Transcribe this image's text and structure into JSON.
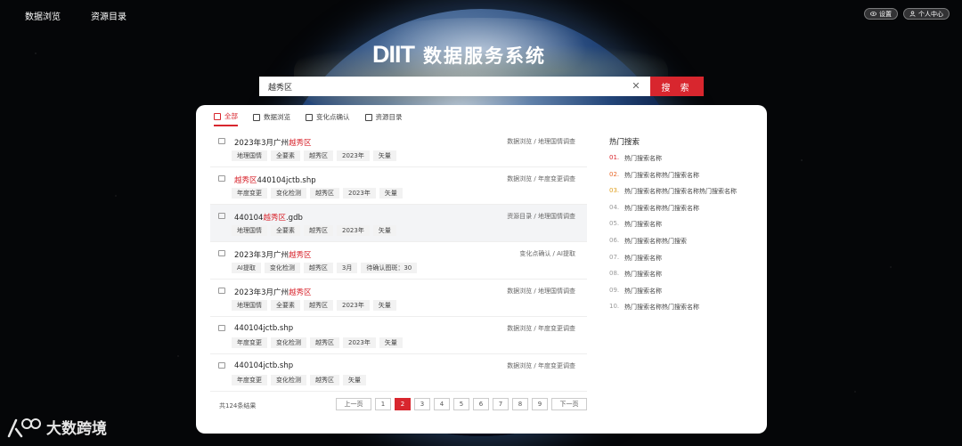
{
  "nav": [
    "数据浏览",
    "资源目录"
  ],
  "topright": {
    "settings": "设置",
    "user": "个人中心"
  },
  "brand": {
    "logo": "DIIT",
    "title": "数据服务系统"
  },
  "search": {
    "value": "越秀区",
    "button": "搜 索"
  },
  "tabs": [
    {
      "label": "全部",
      "active": true
    },
    {
      "label": "数据浏览"
    },
    {
      "label": "变化点确认"
    },
    {
      "label": "资源目录"
    }
  ],
  "results": [
    {
      "pre": "2023年3月广州",
      "hl": "越秀区",
      "post": "",
      "path": "数据浏览 / 地理国情调查",
      "tags": [
        "地理国情",
        "全要素",
        "越秀区",
        "2023年",
        "矢量"
      ]
    },
    {
      "pre": "",
      "hl": "越秀区",
      "post": "440104jctb.shp",
      "path": "数据浏览 / 年度变更调查",
      "tags": [
        "年度变更",
        "变化检测",
        "越秀区",
        "2023年",
        "矢量"
      ]
    },
    {
      "pre": "440104",
      "hl": "越秀区",
      "post": ".gdb",
      "path": "资源目录 / 地理国情调查",
      "tags": [
        "地理国情",
        "全要素",
        "越秀区",
        "2023年",
        "矢量"
      ]
    },
    {
      "pre": "2023年3月广州",
      "hl": "越秀区",
      "post": "",
      "path": "变化点确认 / AI提取",
      "tags": [
        "AI提取",
        "变化检测",
        "越秀区",
        "3月",
        "待确认图斑：30"
      ]
    },
    {
      "pre": "2023年3月广州",
      "hl": "越秀区",
      "post": "",
      "path": "数据浏览 / 地理国情调查",
      "tags": [
        "地理国情",
        "全要素",
        "越秀区",
        "2023年",
        "矢量"
      ]
    },
    {
      "pre": "440104jctb.shp",
      "hl": "",
      "post": "",
      "path": "数据浏览 / 年度变更调查",
      "tags": [
        "年度变更",
        "变化检测",
        "越秀区",
        "2023年",
        "矢量"
      ]
    },
    {
      "pre": "440104jctb.shp",
      "hl": "",
      "post": "",
      "path": "数据浏览 / 年度变更调查",
      "tags": [
        "年度变更",
        "变化检测",
        "越秀区",
        "矢量"
      ]
    }
  ],
  "pagination": {
    "total": "共124条结果",
    "prev": "上一页",
    "next": "下一页",
    "pages": [
      "1",
      "2",
      "3",
      "4",
      "5",
      "6",
      "7",
      "8",
      "9"
    ],
    "current": "2"
  },
  "hot": {
    "title": "热门搜索",
    "items": [
      {
        "num": "01.",
        "label": "热门搜索名称",
        "color": "#d8262e"
      },
      {
        "num": "02.",
        "label": "热门搜索名称热门搜索名称",
        "color": "#e8692b"
      },
      {
        "num": "03.",
        "label": "热门搜索名称热门搜索名称热门搜索名称",
        "color": "#e0a020"
      },
      {
        "num": "04.",
        "label": "热门搜索名称热门搜索名称"
      },
      {
        "num": "05.",
        "label": "热门搜索名称"
      },
      {
        "num": "06.",
        "label": "热门搜索名称热门搜索"
      },
      {
        "num": "07.",
        "label": "热门搜索名称"
      },
      {
        "num": "08.",
        "label": "热门搜索名称"
      },
      {
        "num": "09.",
        "label": "热门搜索名称"
      },
      {
        "num": "10.",
        "label": "热门搜索名称热门搜索名称"
      }
    ]
  },
  "watermark": "大数跨境",
  "colors": {
    "accent": "#d8262e"
  }
}
